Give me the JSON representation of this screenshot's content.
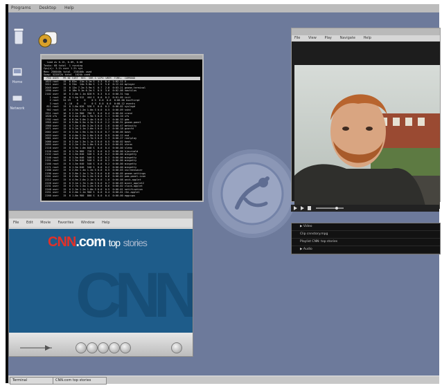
{
  "menubar": {
    "items": [
      "Programs",
      "Desktop",
      "Help"
    ]
  },
  "desktop": {
    "icons": [
      {
        "name": "trash-icon",
        "label": "Trash"
      },
      {
        "name": "home-icon",
        "label": "Home"
      },
      {
        "name": "network-icon",
        "label": "Network"
      }
    ]
  },
  "terminal": {
    "header_lines": [
      "  load av 0.15, 0.09, 0.08   ",
      "Tasks: 68 total  1 running  ",
      "Cpu(s): 3.1% user 1.2% sys  ",
      "Mem: 256040k total  238100k used",
      "Swap: 522072k total  1024k used"
    ],
    "column_header": "  PID USER   PR NI VIRT  RES  SHR S %CPU %MEM  TIME+  COMMAND",
    "rows": [
      " 1823 root   15  0 82m  21m 4.1m S  4.3  8.4  1:02.11 X",
      " 2011 user   15  0 31m  14m 9.8m S  1.9  5.6  0:12.44 mplayer",
      " 2045 user   15  0 12m 7.2m 5.9m S  0.7  2.8  0:03.21 gnome-terminal",
      " 1990 user   15  0 18m 9.1m 6.2m S  0.5  3.6  0:02.08 nautilus",
      " 2102 user   16  0 2.0m 1.1m 820 R  0.3  0.4  0:00.31 top",
      "    1 root   16  0 1.4m 512  444 S  0.0  0.2  0:01.05 init",
      "    2 root   34 19    0    0    0 S  0.0  0.0  0:00.00 ksoftirqd",
      "    3 root    5 -10   0    0    0 S  0.0  0.0  0:00.12 events",
      "  811 root   15  0 1.6m 620  520 S  0.0  0.2  0:00.02 syslogd",
      "  902 root   16  0 2.9m 1.2m 1.0m S 0.0  0.5  0:00.09 sshd",
      " 1511 root   16  0 2.1m 900  760 S  0.0  0.4  0:00.04 crond",
      " 1620 xfs    16  0 4.4m 2.8m 1.9m S 0.0  1.1  0:00.10 xfs",
      " 1702 root   16  0 6.3m 3.0m 2.4m S 0.0  1.2  0:00.33 gdm",
      " 1955 user   15  0 9.8m 5.5m 4.3m S 0.0  2.2  0:00.91 gnome-panel",
      " 1960 user   15  0 7.1m 4.0m 3.2m S 0.0  1.6  0:00.47 metacity",
      " 1971 user   15  0 5.2m 3.1m 2.6m S 0.0  1.2  0:00.18 gconfd",
      " 2002 user   15  0 3.3m 1.9m 1.5m S 0.0  0.7  0:00.06 bash",
      " 2033 user   15  0 4.0m 2.2m 1.8m S 0.0  0.9  0:00.12 esd",
      " 2061 user   15  0 6.6m 3.4m 2.7m S 0.0  1.3  0:00.27 realplay",
      " 2080 user   15  0 2.4m 1.3m 1.1m S 0.0  0.5  0:00.02 bash",
      " 2095 user   15  0 2.2m 1.2m 1.0m S 0.0  0.5  0:00.01 xterm",
      " 2110 user   15  0 1.9m 1.0m 840 S  0.0  0.4  0:00.00 sleep",
      " 2120 root   15  0 1.7m 880  720 S  0.0  0.3  0:00.00 kjournald",
      " 2132 root   15  0 1.5m 640  540 S  0.0  0.2  0:00.00 mingetty",
      " 2140 root   15  0 1.5m 640  540 S  0.0  0.2  0:00.00 mingetty",
      " 2151 root   15  0 1.5m 640  540 S  0.0  0.2  0:00.00 mingetty",
      " 2160 root   15  0 1.5m 640  540 S  0.0  0.2  0:00.00 mingetty",
      " 2171 root   15  0 1.5m 640  540 S  0.0  0.2  0:00.00 mingetty",
      " 2180 user   15  0 2.6m 1.4m 1.2m S 0.0  0.5  0:00.03 xscreensaver",
      " 2190 user   15  0 3.8m 2.1m 1.7m S 0.0  0.8  0:00.05 gnome-settings",
      " 2201 user   15  0 2.8m 1.5m 1.2m S 0.0  0.6  0:00.02 pam-panel-icon",
      " 2212 user   15  0 4.9m 2.6m 2.1m S 0.0  1.0  0:00.08 wnck-applet",
      " 2220 user   15  0 3.1m 1.7m 1.4m S 0.0  0.7  0:00.03 mixer_applet2",
      " 2231 user   15  0 2.7m 1.5m 1.2m S 0.0  0.6  0:00.02 clock-applet",
      " 2240 user   15  0 2.3m 1.2m 1.0m S 0.0  0.5  0:00.01 notification",
      " 2251 user   15  0 2.0m 1.1m 900 S  0.0  0.4  0:00.01 rhn-applet",
      " 2260 user   15  0 1.8m 980  800 S  0.0  0.4  0:00.00 eggcups",
      " 2271 user   15  0 1.6m 860  700 S  0.0  0.3  0:00.00 bonobo-act"
    ]
  },
  "media_player": {
    "menu": [
      "File",
      "View",
      "Play",
      "Navigate",
      "Help"
    ],
    "playlist": [
      {
        "marker": "▶",
        "text": "Video"
      },
      {
        "marker": "",
        "text": "Clip  cnnstory.mpg"
      },
      {
        "marker": "",
        "text": "Playlist  CNN: top stories"
      },
      {
        "marker": "▶",
        "text": "Audio"
      }
    ]
  },
  "quicktime": {
    "menu": [
      "File",
      "Edit",
      "Movie",
      "Favorites",
      "Window",
      "Help"
    ],
    "banner": {
      "cnn": "CNN",
      "dotcom": ".com",
      "top": "top",
      "stories": "stories"
    },
    "big_logo": "CNN"
  },
  "taskbar": {
    "tasks": [
      "Terminal",
      "CNN.com top stories"
    ]
  },
  "colors": {
    "desktop": "#6d7a9b",
    "frame": "#0c0c0c",
    "cnn_red": "#e0312a",
    "qt_blue": "#1e5c8a"
  }
}
